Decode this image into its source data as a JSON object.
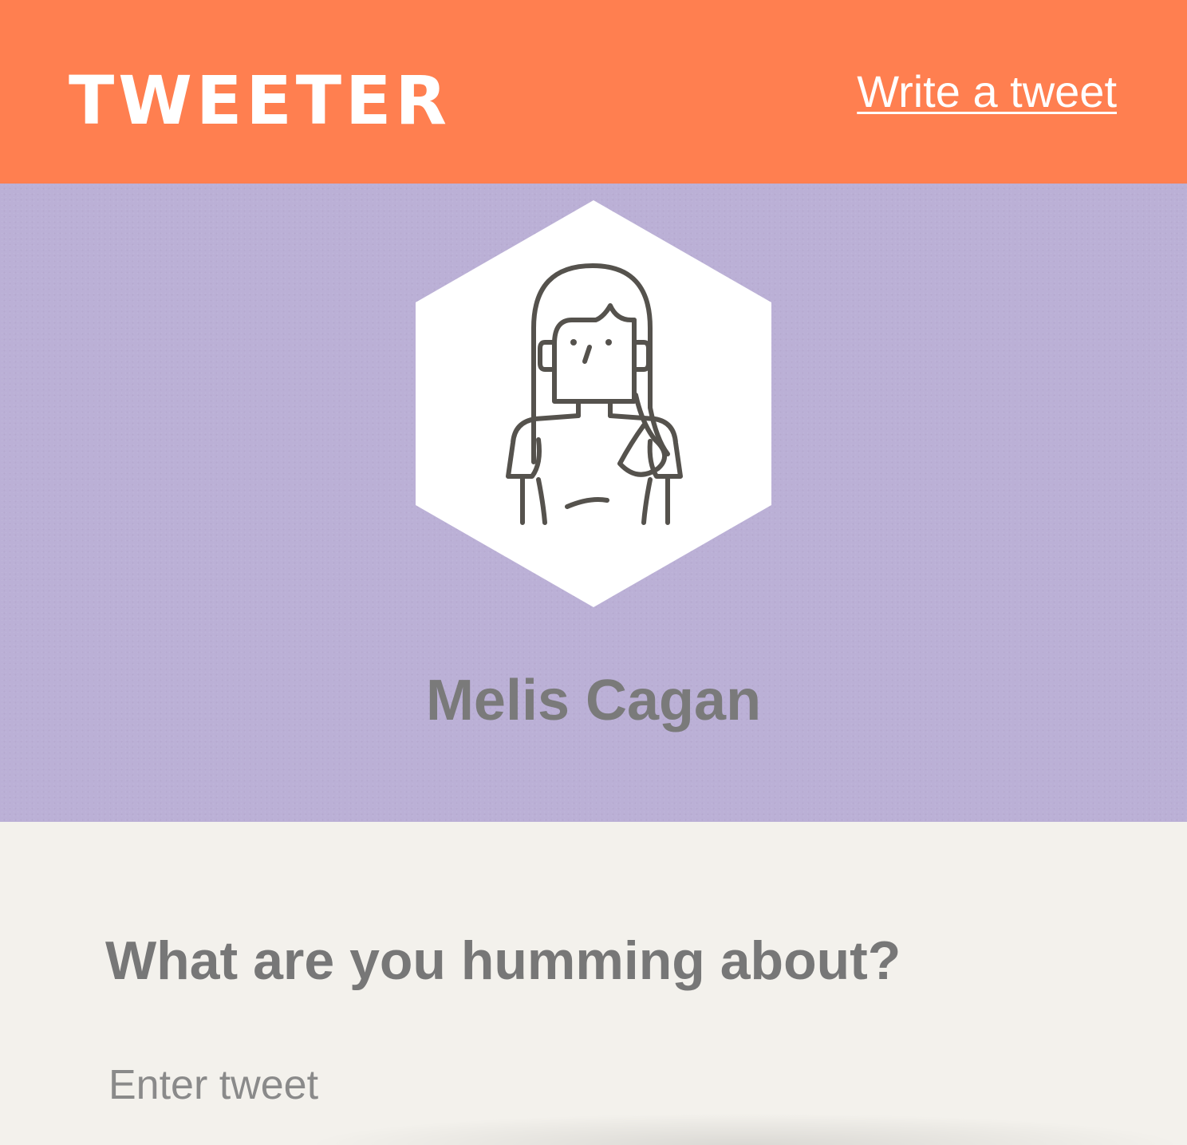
{
  "header": {
    "logo_text": "TWEETER",
    "write_link": "Write a tweet"
  },
  "profile": {
    "avatar_icon": "woman-avatar-icon",
    "name": "Melis Cagan"
  },
  "compose": {
    "prompt": "What are you humming about?",
    "input_placeholder": "Enter tweet",
    "input_value": ""
  },
  "colors": {
    "header_bg": "#ff7f50",
    "profile_bg": "#bbb0d6",
    "page_bg": "#f3f1ec",
    "text_gray": "#7a7a7a",
    "icon_stroke": "#55524d"
  }
}
